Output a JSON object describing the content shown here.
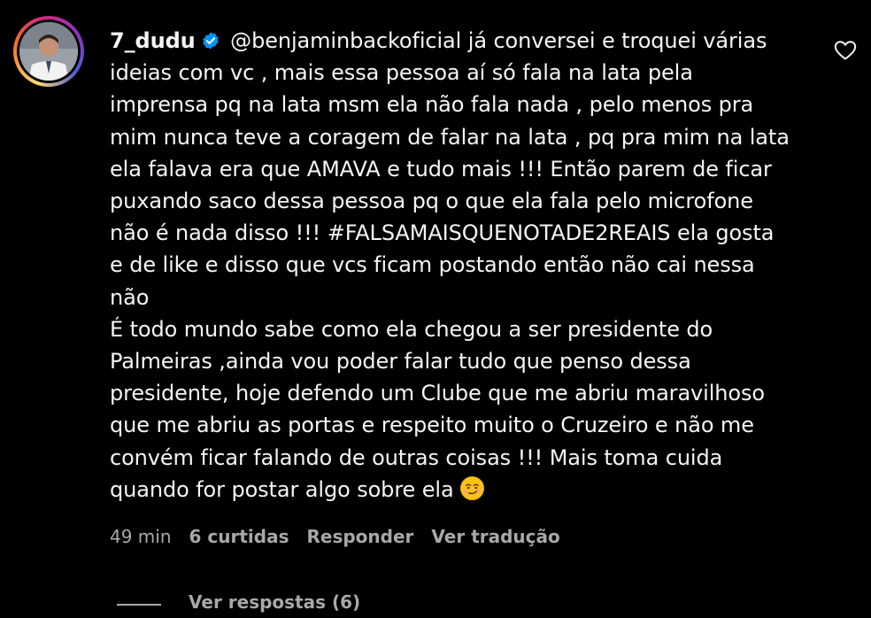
{
  "comment": {
    "username": "7_dudu",
    "verified": true,
    "lines": [
      "@benjaminbackoficial já conversei e troquei várias",
      "ideias com vc , mais essa pessoa aí só fala na lata pela",
      "imprensa pq na lata msm ela não fala nada , pelo menos pra",
      "mim nunca teve a coragem de falar na lata , pq pra mim na lata",
      "ela falava era que AMAVA e tudo mais !!! Então parem de ficar",
      "puxando saco dessa pessoa pq o que ela fala pelo microfone",
      "não é nada disso !!! #FALSAMAISQUENOTADE2REAIS ela gosta",
      "e de like e disso que vcs ficam postando então não cai nessa",
      "não",
      "É todo mundo sabe como ela chegou a ser presidente do",
      "Palmeiras ,ainda vou poder falar tudo que penso dessa",
      "presidente, hoje defendo um Clube que me abriu maravilhoso",
      "que me abriu as portas e respeito muito o Cruzeiro e não me",
      "convém ficar falando de outras coisas !!! Mais toma cuida",
      "quando for postar algo sobre ela"
    ],
    "emoji": "smirk-emoji"
  },
  "meta": {
    "time": "49 min",
    "likes": "6 curtidas",
    "reply": "Responder",
    "translate": "Ver tradução"
  },
  "replies": {
    "label": "Ver respostas (6)"
  },
  "colors": {
    "background": "#000000",
    "text": "#f5f5f5",
    "muted": "#a8a8a8",
    "verified": "#0095f6"
  }
}
